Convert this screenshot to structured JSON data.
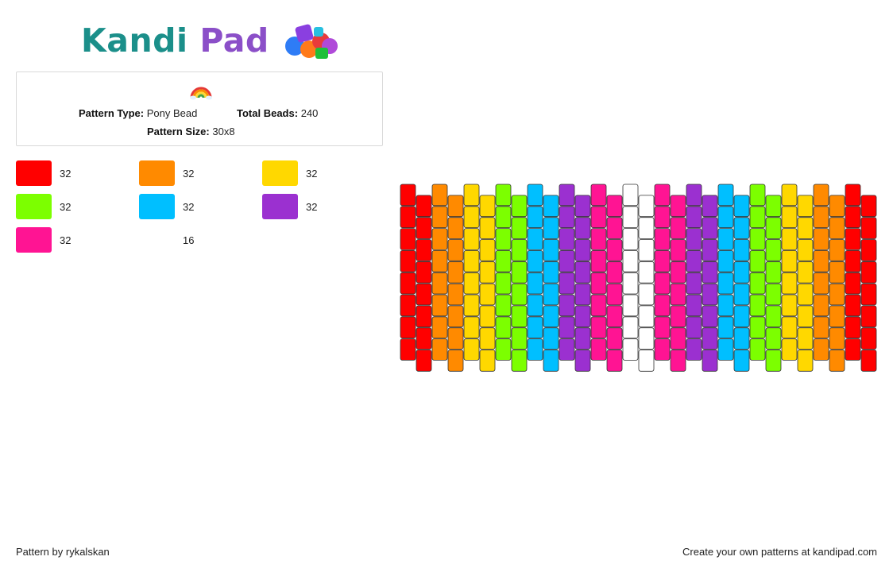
{
  "logo": {
    "kandi": "Kandi",
    "pad": "Pad",
    "icon": "beads-icon"
  },
  "pattern": {
    "icon": "rainbow-icon",
    "type_label": "Pattern Type:",
    "type_value": "Pony Bead",
    "total_label": "Total Beads:",
    "total_value": "240",
    "size_label": "Pattern Size:",
    "size_value": "30x8"
  },
  "legend": [
    {
      "color": "#ff0000",
      "count": "32"
    },
    {
      "color": "#ff8a00",
      "count": "32"
    },
    {
      "color": "#ffd800",
      "count": "32"
    },
    {
      "color": "#7cff00",
      "count": "32"
    },
    {
      "color": "#00bfff",
      "count": "32"
    },
    {
      "color": "#9b30d0",
      "count": "32"
    },
    {
      "color": "#ff1493",
      "count": "32"
    },
    {
      "color": "#ffffff",
      "count": "16"
    }
  ],
  "bead_columns": [
    "#ff0000",
    "#ff0000",
    "#ff8a00",
    "#ff8a00",
    "#ffd800",
    "#ffd800",
    "#7cff00",
    "#7cff00",
    "#00bfff",
    "#00bfff",
    "#9b30d0",
    "#9b30d0",
    "#ff1493",
    "#ff1493",
    "#ffffff",
    "#ffffff",
    "#ff1493",
    "#ff1493",
    "#9b30d0",
    "#9b30d0",
    "#00bfff",
    "#00bfff",
    "#7cff00",
    "#7cff00",
    "#ffd800",
    "#ffd800",
    "#ff8a00",
    "#ff8a00",
    "#ff0000",
    "#ff0000"
  ],
  "bead_rows": 8,
  "footer": {
    "left": "Pattern by rykalskan",
    "right": "Create your own patterns at kandipad.com"
  }
}
